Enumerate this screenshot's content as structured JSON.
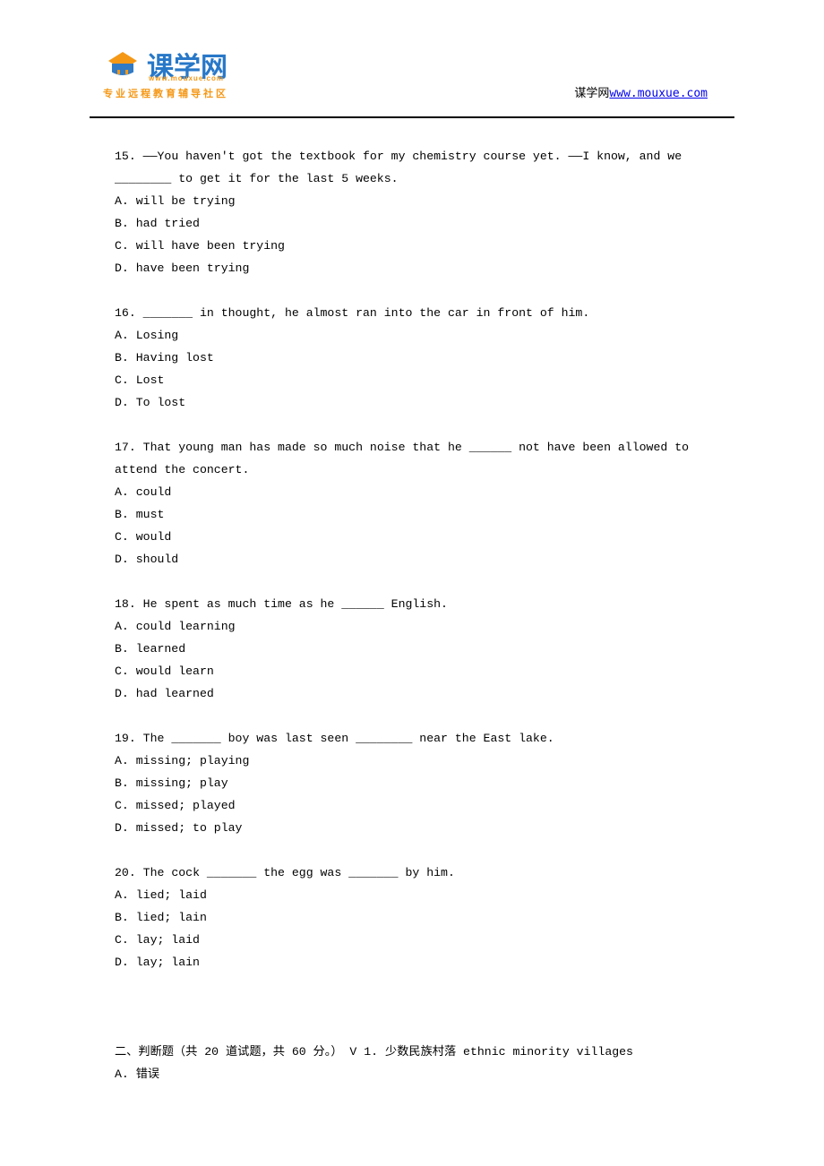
{
  "logo": {
    "brand": "课学网",
    "url_text": "www.mouxue.com",
    "subtitle": "专业远程教育辅导社区"
  },
  "header_link": {
    "prefix": "谋学网",
    "url": "www.mouxue.com"
  },
  "questions": [
    {
      "num": "15.",
      "text": " ——You haven't got the textbook for my chemistry course yet. ——I know, and we ________ to get it for the last 5 weeks.",
      "options": [
        "A. will be trying",
        "B. had tried",
        "C. will have been trying",
        "D. have been trying"
      ]
    },
    {
      "num": "16.",
      "text": " _______ in thought, he almost ran into the car in front of him.",
      "options": [
        "A. Losing",
        "B. Having lost",
        "C. Lost",
        "D. To lost"
      ]
    },
    {
      "num": "17.",
      "text": " That young man has made so much noise that he ______ not have been allowed to attend the concert.",
      "options": [
        "A. could",
        "B. must",
        "C. would",
        "D. should"
      ]
    },
    {
      "num": "18.",
      "text": " He spent as much time as he ______ English.",
      "options": [
        "A. could learning",
        "B. learned",
        "C. would learn",
        "D. had learned"
      ]
    },
    {
      "num": "19.",
      "text": " The _______ boy was last seen ________ near the East lake.",
      "options": [
        "A. missing; playing",
        "B. missing; play",
        "C. missed; played",
        "D. missed; to play"
      ]
    },
    {
      "num": "20.",
      "text": " The cock _______ the egg was _______ by him.",
      "options": [
        "A. lied; laid",
        "B. lied; lain",
        "C. lay; laid",
        "D. lay; lain"
      ]
    }
  ],
  "section2": {
    "heading": "二、判断题（共 20 道试题，共 60 分。）  V 1.  少数民族村落 ethnic minority villages",
    "option": "A. 错误"
  }
}
